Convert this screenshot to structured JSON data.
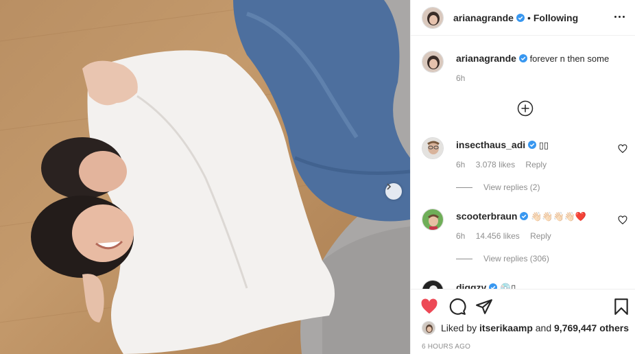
{
  "post": {
    "author": "arianagrande",
    "follow_status": "Following",
    "caption": "forever n then some",
    "caption_time": "6h"
  },
  "icons": {
    "verified": "verified-badge-icon",
    "more": "more-options-icon",
    "next": "chevron-right-icon",
    "load_more": "plus-circle-icon",
    "like": "heart-filled-icon",
    "comment": "comment-bubble-icon",
    "share": "paper-plane-icon",
    "save": "bookmark-icon"
  },
  "colors": {
    "like_red": "#ed4956",
    "verified_blue": "#3897f0",
    "muted": "#8e8e8e"
  },
  "comments": [
    {
      "username": "insecthaus_adi",
      "text": "▯▯",
      "time": "6h",
      "likes": "3.078 likes",
      "reply": "Reply",
      "view_replies": "View replies (2)"
    },
    {
      "username": "scooterbraun",
      "text": "👋🏻👋🏻👋🏻👋🏻❤️",
      "time": "6h",
      "likes": "14.456 likes",
      "reply": "Reply",
      "view_replies": "View replies (306)"
    },
    {
      "username": "diggzy",
      "text": "💿▯"
    }
  ],
  "liked_by": {
    "prefix": "Liked by",
    "user": "itserikaamp",
    "middle": "and",
    "count": "9,769,447 others"
  },
  "timestamp": "6 HOURS AGO"
}
